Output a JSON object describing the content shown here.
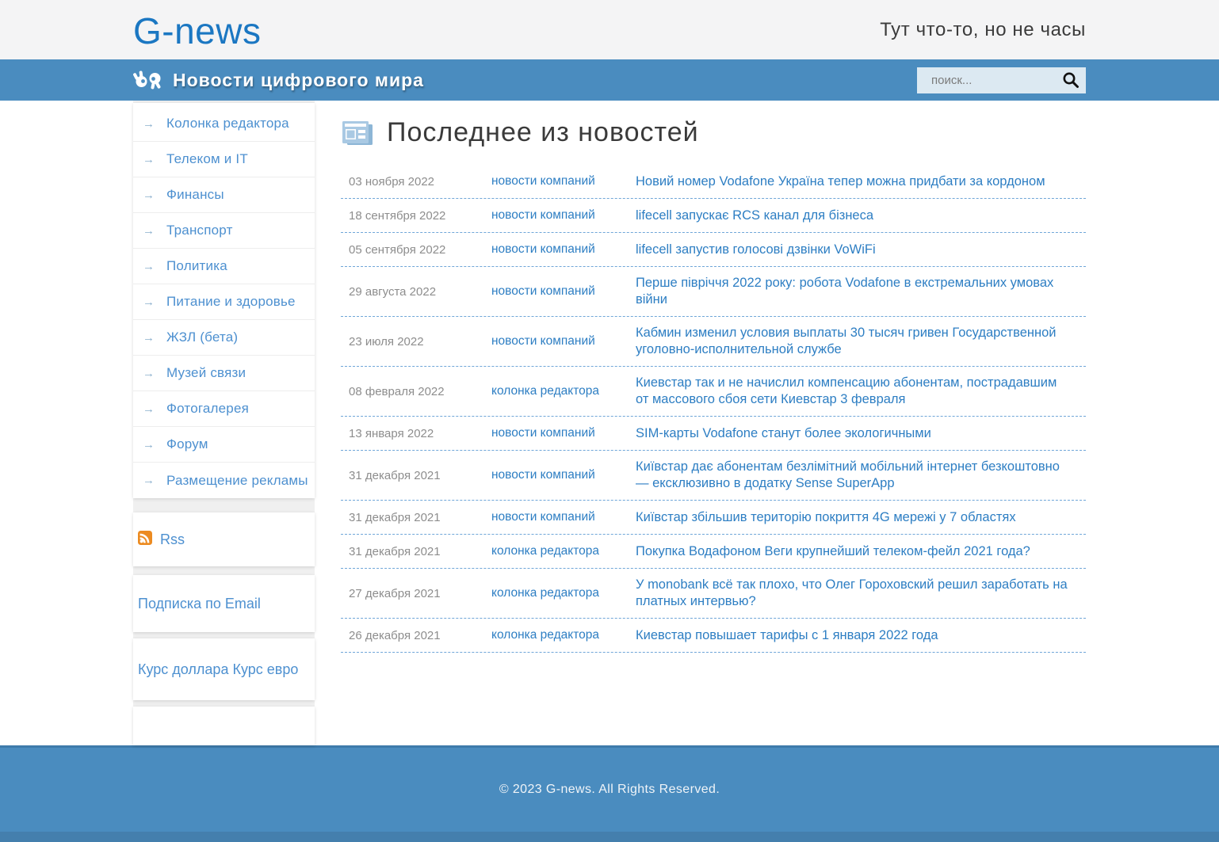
{
  "header": {
    "logo": "G-news",
    "tagline": "Тут что-то, но не часы"
  },
  "navbar": {
    "site_title": "Новости цифрового мира",
    "search_placeholder": "поиск...",
    "bar_color": "#4a8cbf"
  },
  "icons": {
    "arrow_glyph": "→",
    "hands_icon": "hands-icon",
    "search_icon": "search-icon",
    "newspaper_icon": "newspaper-icon",
    "rss_icon": "rss-icon"
  },
  "colors": {
    "logo_blue": "#1b77c2",
    "bar_blue": "#4a8cbf",
    "link_blue": "#2d7ec3",
    "sidebar_link_blue": "#4d90d0",
    "date_gray": "#8d8d8d",
    "rss_orange": "#ec8b21"
  },
  "sidebar": {
    "menu": [
      "Колонка редактора",
      "Телеком и IT",
      "Финансы",
      "Транспорт",
      "Политика",
      "Питание и здоровье",
      "ЖЗЛ (бета)",
      "Музей связи",
      "Фотогалерея",
      "Форум",
      "Размещение рекламы"
    ],
    "rss_label": "Rss",
    "email_label": "Подписка по Email",
    "currency_label": "Курс доллара Курс евро"
  },
  "main": {
    "heading": "Последнее из новостей",
    "news": [
      {
        "date": "03 ноября 2022",
        "category": "новости компаний",
        "title": "Новий номер Vodafone Україна тепер можна придбати за кордоном"
      },
      {
        "date": "18 сентября 2022",
        "category": "новости компаний",
        "title": "lifecell запускає RCS канал для бізнеса"
      },
      {
        "date": "05 сентября 2022",
        "category": "новости компаний",
        "title": "lifecell запустив голосові дзвінки VoWiFi"
      },
      {
        "date": "29 августа 2022",
        "category": "новости компаний",
        "title": "Перше півріччя 2022 року: робота Vodafone в екстремальних умовах війни"
      },
      {
        "date": "23 июля 2022",
        "category": "новости компаний",
        "title": "Кабмин изменил условия выплаты 30 тысяч гривен Государственной уголовно-исполнительной службе"
      },
      {
        "date": "08 февраля 2022",
        "category": "колонка редактора",
        "title": "Киевстар так и не начислил компенсацию абонентам, пострадавшим от массового сбоя сети Киевстар 3 февраля"
      },
      {
        "date": "13 января 2022",
        "category": "новости компаний",
        "title": "SIM-карты Vodafone станут более экологичными"
      },
      {
        "date": "31 декабря 2021",
        "category": "новости компаний",
        "title": "Київстар дає абонентам безлімітний мобільний інтернет безкоштовно — ексклюзивно в додатку Sense SuperApp"
      },
      {
        "date": "31 декабря 2021",
        "category": "новости компаний",
        "title": "Київстар збільшив територію покриття 4G мережі у 7 областях"
      },
      {
        "date": "31 декабря 2021",
        "category": "колонка редактора",
        "title": "Покупка Водафоном Веги крупнейший телеком-фейл 2021 года?"
      },
      {
        "date": "27 декабря 2021",
        "category": "колонка редактора",
        "title": "У monobank всё так плохо, что Олег Гороховский решил заработать на платных интервью?"
      },
      {
        "date": "26 декабря 2021",
        "category": "колонка редактора",
        "title": "Киевстар повышает тарифы с 1 января 2022 года"
      }
    ]
  },
  "footer": {
    "copyright": "© 2023 G-news. All Rights Reserved."
  }
}
